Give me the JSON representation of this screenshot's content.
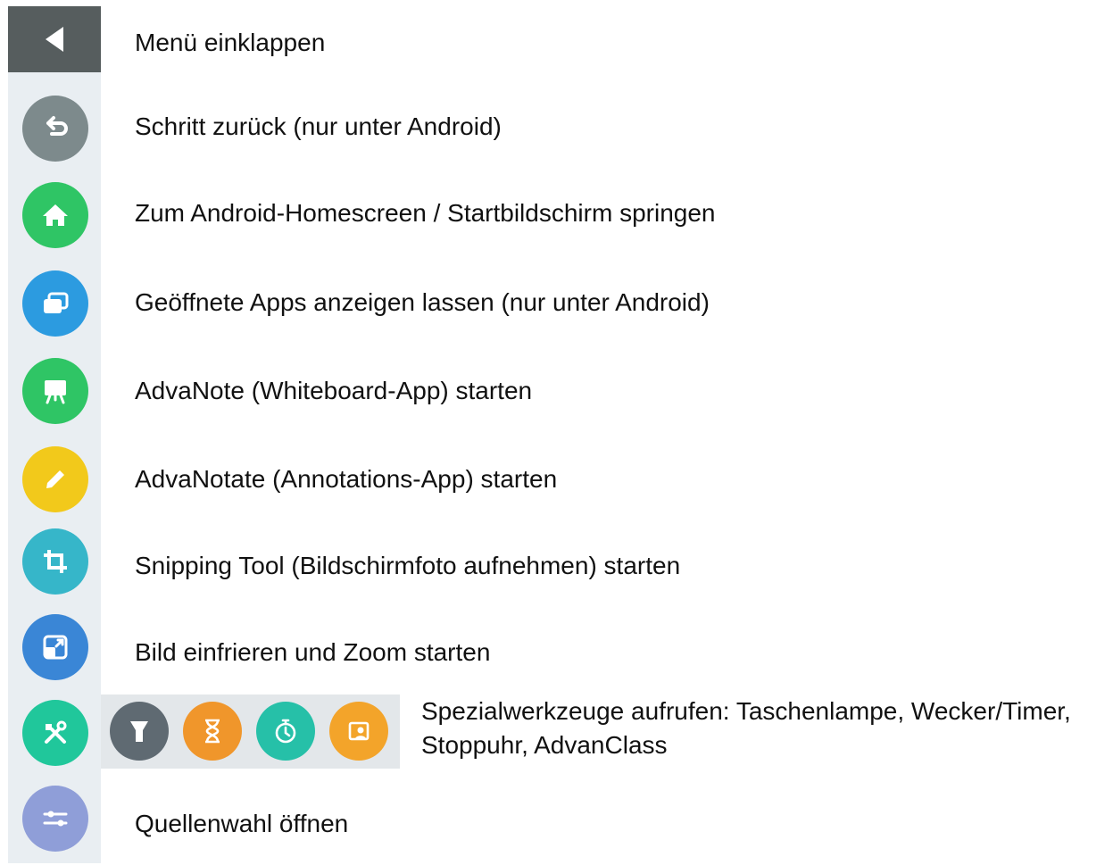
{
  "menu": {
    "collapse_label": "Menü einklappen",
    "items": [
      {
        "icon": "back-icon",
        "color": "#7d8a8c",
        "label": "Schritt zurück (nur unter Android)"
      },
      {
        "icon": "home-icon",
        "color": "#2fc565",
        "label": "Zum Android-Homescreen / Startbildschirm springen"
      },
      {
        "icon": "windows-icon",
        "color": "#2c9be0",
        "label": "Geöffnete Apps anzeigen lassen (nur unter Android)"
      },
      {
        "icon": "whiteboard-icon",
        "color": "#2fc565",
        "label": "AdvaNote (Whiteboard-App) starten"
      },
      {
        "icon": "pencil-icon",
        "color": "#f2c91b",
        "label": "AdvaNotate (Annotations-App) starten"
      },
      {
        "icon": "crop-icon",
        "color": "#36b6c9",
        "label": "Snipping Tool (Bildschirmfoto aufnehmen) starten"
      },
      {
        "icon": "zoom-icon",
        "color": "#3a86d6",
        "label": "Bild einfrieren und Zoom starten"
      },
      {
        "icon": "tools-icon",
        "color": "#20c79b",
        "label": "Spezialwerkzeuge aufrufen: Taschenlampe, Wecker/Timer, Stoppuhr, AdvanClass"
      },
      {
        "icon": "source-icon",
        "color": "#8f9ed8",
        "label": "Quellenwahl öffnen"
      }
    ]
  },
  "special_tools": [
    {
      "icon": "flashlight-icon",
      "color": "#5f6a72"
    },
    {
      "icon": "hourglass-icon",
      "color": "#f0962b"
    },
    {
      "icon": "stopwatch-icon",
      "color": "#26c0a8"
    },
    {
      "icon": "advanclass-icon",
      "color": "#f3a42a"
    }
  ]
}
